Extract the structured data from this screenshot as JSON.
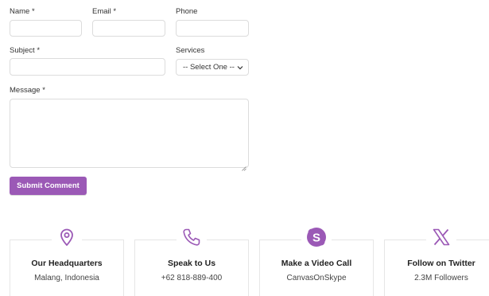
{
  "form": {
    "name_label": "Name",
    "email_label": "Email",
    "phone_label": "Phone",
    "subject_label": "Subject",
    "services_label": "Services",
    "services_selected": "-- Select One --",
    "message_label": "Message",
    "required_mark": "*",
    "name_value": "",
    "email_value": "",
    "phone_value": "",
    "subject_value": "",
    "message_value": "",
    "submit_label": "Submit Comment"
  },
  "cards": [
    {
      "icon": "map-pin-icon",
      "title": "Our Headquarters",
      "subtitle": "Malang, Indonesia"
    },
    {
      "icon": "phone-icon",
      "title": "Speak to Us",
      "subtitle": "+62 818-889-400"
    },
    {
      "icon": "skype-icon",
      "title": "Make a Video Call",
      "subtitle": "CanvasOnSkype"
    },
    {
      "icon": "x-twitter-icon",
      "title": "Follow on Twitter",
      "subtitle": "2.3M Followers"
    }
  ],
  "colors": {
    "accent": "#9b59b6",
    "border": "#dcdcdc"
  }
}
